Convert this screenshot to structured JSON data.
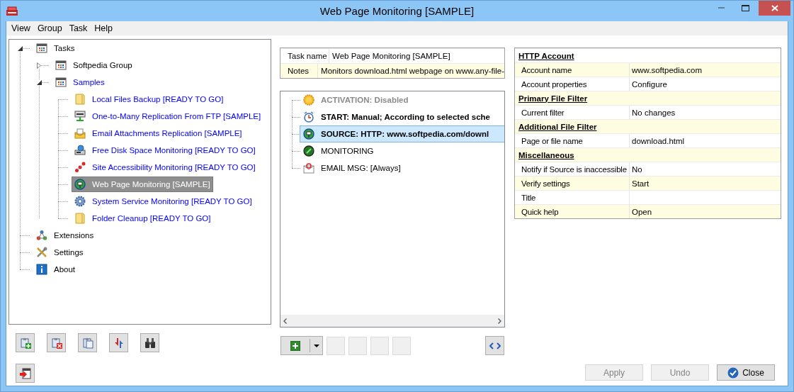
{
  "window": {
    "title": "Web Page Monitoring [SAMPLE]"
  },
  "menu": [
    "View",
    "Group",
    "Task",
    "Help"
  ],
  "tree": [
    {
      "label": "Tasks",
      "kind": "group",
      "color": "#000000",
      "expanded": true,
      "selected": false,
      "children": [
        {
          "label": "Softpedia Group",
          "kind": "group",
          "color": "#000000",
          "expanded": false,
          "selected": false
        },
        {
          "label": "Samples",
          "kind": "group",
          "color": "#0000ff",
          "expanded": true,
          "selected": false,
          "children": [
            {
              "label": "Local Files Backup [READY TO GO]",
              "kind": "folder",
              "color": "#0000ff",
              "selected": false
            },
            {
              "label": "One-to-Many Replication From FTP [SAMPLE]",
              "kind": "server",
              "color": "#0000ff",
              "selected": false
            },
            {
              "label": "Email Attachments Replication [SAMPLE]",
              "kind": "inbox",
              "color": "#0000ff",
              "selected": false
            },
            {
              "label": "Free Disk Space Monitoring [READY TO GO]",
              "kind": "computer",
              "color": "#0000ff",
              "selected": false
            },
            {
              "label": "Site Accessibility Monitoring [READY TO GO]",
              "kind": "nodes",
              "color": "#0000ff",
              "selected": false
            },
            {
              "label": "Web Page Monitoring [SAMPLE]",
              "kind": "globe",
              "selected": true
            },
            {
              "label": "System Service Monitoring [READY TO GO]",
              "kind": "gear",
              "color": "#0000ff",
              "selected": false
            },
            {
              "label": "Folder Cleanup [READY TO GO]",
              "kind": "folder",
              "color": "#0000ff",
              "selected": false
            }
          ]
        }
      ]
    },
    {
      "label": "Extensions",
      "kind": "network",
      "color": "#000000",
      "selected": false
    },
    {
      "label": "Settings",
      "kind": "tools",
      "color": "#000000",
      "selected": false
    },
    {
      "label": "About",
      "kind": "info",
      "color": "#000000",
      "selected": false
    }
  ],
  "task_info": [
    {
      "label": "Task name",
      "value": "Web Page Monitoring [SAMPLE]"
    },
    {
      "label": "Notes",
      "value": "Monitors download.html webpage on www.any-file-"
    }
  ],
  "steps": [
    {
      "text": "ACTIVATION: Disabled",
      "kind": "sun",
      "bold": true,
      "disabled": true,
      "selected": false
    },
    {
      "text": "START: Manual; According to selected sche",
      "kind": "clock",
      "bold": true,
      "disabled": false,
      "selected": false
    },
    {
      "text": "SOURCE: HTTP: www.softpedia.com/downl",
      "kind": "globe",
      "bold": true,
      "disabled": false,
      "selected": true
    },
    {
      "text": "MONITORING",
      "kind": "dot",
      "bold": false,
      "disabled": false,
      "selected": false
    },
    {
      "text": "EMAIL MSG:  [Always]",
      "kind": "envelope",
      "bold": false,
      "disabled": false,
      "selected": false
    }
  ],
  "properties": [
    {
      "category": "HTTP Account",
      "rows": [
        {
          "name": "Account name",
          "value": "www.softpedia.com"
        },
        {
          "name": "Account properties",
          "value": "Configure"
        }
      ]
    },
    {
      "category": "Primary File Filter",
      "rows": [
        {
          "name": "Current filter",
          "value": "No changes"
        }
      ]
    },
    {
      "category": "Additional File Filter",
      "rows": [
        {
          "name": "Page or file name",
          "value": "download.html"
        }
      ]
    },
    {
      "category": "Miscellaneous",
      "rows": [
        {
          "name": "Notify if Source is inaccessible",
          "value": "No"
        },
        {
          "name": "Verify settings",
          "value": "Start"
        },
        {
          "name": "Title"
        },
        {
          "name": "Quick help",
          "value": "Open"
        }
      ]
    }
  ],
  "buttons": [
    {
      "label": "Apply",
      "kind": "plain",
      "disabled": true
    },
    {
      "label": "Undo",
      "kind": "plain",
      "disabled": true
    },
    {
      "label": "Close",
      "kind": "confirm",
      "disabled": false
    }
  ]
}
